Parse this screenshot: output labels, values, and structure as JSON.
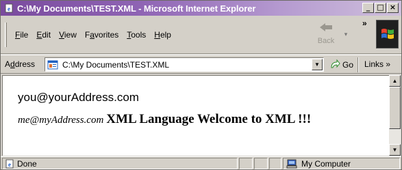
{
  "window": {
    "title": "C:\\My Documents\\TEST.XML - Microsoft Internet Explorer",
    "buttons": {
      "minimize": "_",
      "maximize": "□",
      "close": "×"
    }
  },
  "menu": {
    "items": [
      {
        "pre": "",
        "key": "F",
        "post": "ile"
      },
      {
        "pre": "",
        "key": "E",
        "post": "dit"
      },
      {
        "pre": "",
        "key": "V",
        "post": "iew"
      },
      {
        "pre": "F",
        "key": "a",
        "post": "vorites"
      },
      {
        "pre": "",
        "key": "T",
        "post": "ools"
      },
      {
        "pre": "",
        "key": "H",
        "post": "elp"
      }
    ]
  },
  "toolbar": {
    "back_label": "Back",
    "chevron": "»"
  },
  "address": {
    "label_pre": "A",
    "label_key": "d",
    "label_post": "dress",
    "value": "C:\\My Documents\\TEST.XML",
    "go_label": "Go",
    "links_label": "Links »"
  },
  "content": {
    "line1": "you@yourAddress.com",
    "email2": "me@myAddress.com",
    "welcome": "XML Language Welcome to XML !!!"
  },
  "status": {
    "text": "Done",
    "zone": "My Computer"
  },
  "colors": {
    "title_gradient_start": "#7a4b9e",
    "title_gradient_end": "#cfc0dc",
    "chrome": "#d4d0c8",
    "content_bg": "#ffffff"
  },
  "icons": {
    "title": "ie-page-icon",
    "back": "back-arrow-icon",
    "logo": "windows-logo-icon",
    "address_page": "xml-page-icon",
    "go": "go-arrow-icon",
    "status": "ie-page-icon",
    "zone": "my-computer-icon"
  }
}
